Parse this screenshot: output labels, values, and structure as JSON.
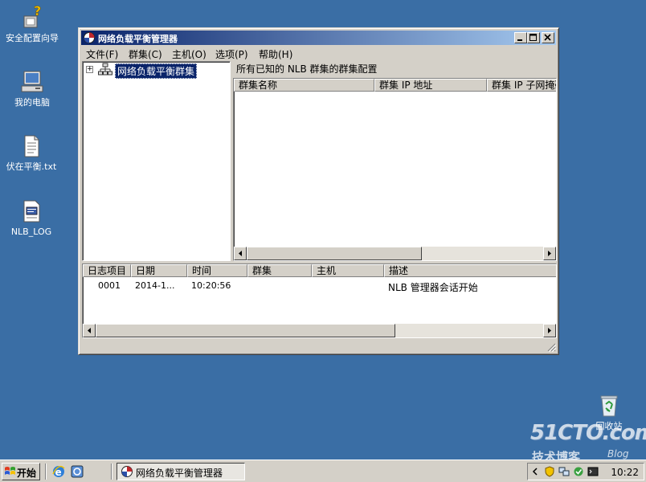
{
  "desktop": {
    "icons": [
      {
        "label": "安全配置向导",
        "icon": "security-wizard-icon"
      },
      {
        "label": "我的电脑",
        "icon": "my-computer-icon"
      },
      {
        "label": "伏在平衡.txt",
        "icon": "text-file-icon"
      },
      {
        "label": "NLB_LOG",
        "icon": "log-file-icon"
      },
      {
        "label": "回收站",
        "icon": "recycle-bin-icon"
      }
    ]
  },
  "window": {
    "title": "网络负载平衡管理器",
    "menu": [
      "文件(F)",
      "群集(C)",
      "主机(O)",
      "选项(P)",
      "帮助(H)"
    ],
    "tree": {
      "root_label": "网络负载平衡群集",
      "expander": "+"
    },
    "cluster_panel": {
      "heading": "所有已知的 NLB 群集的群集配置",
      "columns": [
        "群集名称",
        "群集 IP 地址",
        "群集 IP 子网掩码"
      ]
    },
    "log_panel": {
      "columns": [
        "日志项目",
        "日期",
        "时间",
        "群集",
        "主机",
        "描述"
      ],
      "rows": [
        {
          "entry": "0001",
          "date": "2014-1...",
          "time": "10:20:56",
          "cluster": "",
          "host": "",
          "desc": "NLB 管理器会话开始"
        }
      ]
    }
  },
  "taskbar": {
    "start_label": "开始",
    "task_label": "网络负载平衡管理器",
    "clock": "10:22"
  },
  "watermark": {
    "brand": "51CTO.com",
    "subtitle": "技术博客",
    "blog": "Blog"
  }
}
